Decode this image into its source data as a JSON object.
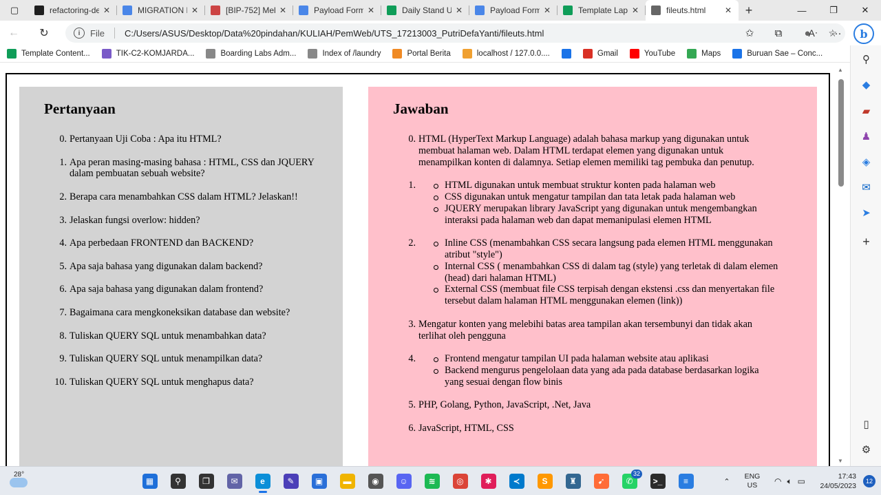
{
  "browser": {
    "tabs": [
      {
        "label": "refactoring-de",
        "icon": "github-icon",
        "color": "#1f1f1f"
      },
      {
        "label": "MIGRATION D",
        "icon": "docs-icon",
        "color": "#4a86e8"
      },
      {
        "label": "[BIP-752] Mel",
        "icon": "jira-icon",
        "color": "#c44"
      },
      {
        "label": "Payload Form",
        "icon": "docs-icon",
        "color": "#4a86e8"
      },
      {
        "label": "Daily Stand U",
        "icon": "sheets-icon",
        "color": "#0f9d58"
      },
      {
        "label": "Payload Form",
        "icon": "docs-icon",
        "color": "#4a86e8"
      },
      {
        "label": "Template Lap",
        "icon": "sheets-icon",
        "color": "#0f9d58"
      },
      {
        "label": "fileuts.html",
        "icon": "file-icon",
        "color": "#666666",
        "active": true
      }
    ],
    "address": {
      "scheme_label": "File",
      "url": "C:/Users/ASUS/Desktop/Data%20pindahan/KULIAH/PemWeb/UTS_17213003_PutriDefaYanti/fileuts.html"
    },
    "bookmarks": [
      {
        "label": "Template Content...",
        "icon": "sheets-icon",
        "color": "#0f9d58"
      },
      {
        "label": "TIK-C2-KOMJARDA...",
        "icon": "globe-icon",
        "color": "#7a5ac8"
      },
      {
        "label": "Boarding Labs Adm...",
        "icon": "page-icon",
        "color": "#888"
      },
      {
        "label": "Index of /laundry",
        "icon": "page-icon",
        "color": "#888"
      },
      {
        "label": "Portal Berita",
        "icon": "portal-icon",
        "color": "#f08a24"
      },
      {
        "label": "localhost / 127.0.0....",
        "icon": "phpmyadmin-icon",
        "color": "#f0a030"
      },
      {
        "label": "",
        "icon": "chat-icon",
        "color": "#1a73e8"
      },
      {
        "label": "Gmail",
        "icon": "gmail-icon",
        "color": "#d93025"
      },
      {
        "label": "YouTube",
        "icon": "youtube-icon",
        "color": "#ff0000"
      },
      {
        "label": "Maps",
        "icon": "maps-icon",
        "color": "#34a853"
      },
      {
        "label": "Buruan Sae – Conc...",
        "icon": "chat-icon",
        "color": "#1a73e8"
      }
    ]
  },
  "page": {
    "left_heading": "Pertanyaan",
    "right_heading": "Jawaban",
    "questions": [
      {
        "num": "0.",
        "text": "Pertanyaan Uji Coba : Apa itu HTML?"
      },
      {
        "num": "1.",
        "text": "Apa peran masing-masing bahasa : HTML, CSS dan JQUERY dalam pembuatan sebuah website?"
      },
      {
        "num": "2.",
        "text": "Berapa cara menambahkan CSS dalam HTML? Jelaskan!!"
      },
      {
        "num": "3.",
        "text": "Jelaskan fungsi overlow: hidden?"
      },
      {
        "num": "4.",
        "text": "Apa perbedaan FRONTEND dan BACKEND?"
      },
      {
        "num": "5.",
        "text": "Apa saja bahasa yang digunakan dalam backend?"
      },
      {
        "num": "6.",
        "text": "Apa saja bahasa yang digunakan dalam frontend?"
      },
      {
        "num": "7.",
        "text": "Bagaimana cara mengkoneksikan database dan website?"
      },
      {
        "num": "8.",
        "text": "Tuliskan QUERY SQL untuk menambahkan data?"
      },
      {
        "num": "9.",
        "text": "Tuliskan QUERY SQL untuk menampilkan data?"
      },
      {
        "num": "10.",
        "text": "Tuliskan QUERY SQL untuk menghapus data?"
      }
    ],
    "answers": [
      {
        "num": "0.",
        "text": "HTML (HyperText Markup Language) adalah bahasa markup yang digunakan untuk membuat halaman web. Dalam HTML terdapat elemen yang digunakan untuk menampilkan konten di dalamnya. Setiap elemen memiliki tag pembuka dan penutup.",
        "items": []
      },
      {
        "num": "1.",
        "text": "",
        "items": [
          "HTML digunakan untuk membuat struktur konten pada halaman web",
          "CSS digunakan untuk mengatur tampilan dan tata letak pada halaman web",
          "JQUERY merupakan library JavaScript yang digunakan untuk mengembangkan interaksi pada halaman web dan dapat memanipulasi elemen HTML"
        ]
      },
      {
        "num": "2.",
        "text": "",
        "items": [
          "Inline CSS (menambahkan CSS secara langsung pada elemen HTML menggunakan atribut \"style\")",
          "Internal CSS ( menambahkan CSS di dalam tag (style) yang terletak di dalam elemen (head) dari halaman HTML)",
          "External CSS (membuat file CSS terpisah dengan ekstensi .css dan menyertakan file tersebut dalam halaman HTML menggunakan elemen (link))"
        ]
      },
      {
        "num": "3.",
        "text": "Mengatur konten yang melebihi batas area tampilan akan tersembunyi dan tidak akan terlihat oleh pengguna",
        "items": []
      },
      {
        "num": "4.",
        "text": "",
        "items": [
          "Frontend mengatur tampilan UI pada halaman website atau aplikasi",
          "Backend mengurus pengelolaan data yang ada pada database berdasarkan logika yang sesuai dengan flow binis"
        ]
      },
      {
        "num": "5.",
        "text": "PHP, Golang, Python, JavaScript, .Net, Java",
        "items": []
      },
      {
        "num": "6.",
        "text": "JavaScript, HTML, CSS",
        "items": []
      }
    ],
    "colors": {
      "left_bg": "#d3d3d3",
      "right_bg": "#ffc0cb"
    }
  },
  "taskbar": {
    "weather_temp": "28°",
    "apps": [
      {
        "name": "start",
        "icon": "windows-icon",
        "color": "#1e6fd9",
        "glyph": "▦"
      },
      {
        "name": "search",
        "icon": "search-icon",
        "color": "#333",
        "glyph": "⚲"
      },
      {
        "name": "task-view",
        "icon": "taskview-icon",
        "color": "#333",
        "glyph": "❐"
      },
      {
        "name": "teams-chat",
        "icon": "chat-icon",
        "color": "#6264a7",
        "glyph": "✉"
      },
      {
        "name": "edge",
        "icon": "edge-icon",
        "color": "#0c8fd8",
        "glyph": "e",
        "active": true
      },
      {
        "name": "vs-editor",
        "icon": "editor-icon",
        "color": "#4b3fb8",
        "glyph": "✎"
      },
      {
        "name": "store",
        "icon": "store-icon",
        "color": "#2a6fd8",
        "glyph": "▣"
      },
      {
        "name": "explorer",
        "icon": "folder-icon",
        "color": "#f0b400",
        "glyph": "▬"
      },
      {
        "name": "camera",
        "icon": "camera-icon",
        "color": "#555",
        "glyph": "◉"
      },
      {
        "name": "discord",
        "icon": "discord-icon",
        "color": "#5865f2",
        "glyph": "☺"
      },
      {
        "name": "spotify",
        "icon": "spotify-icon",
        "color": "#1db954",
        "glyph": "≋"
      },
      {
        "name": "chrome",
        "icon": "chrome-icon",
        "color": "#db4437",
        "glyph": "◎"
      },
      {
        "name": "slack",
        "icon": "slack-icon",
        "color": "#e01e5a",
        "glyph": "✱"
      },
      {
        "name": "vscode",
        "icon": "vscode-icon",
        "color": "#007acc",
        "glyph": "≺"
      },
      {
        "name": "sublime",
        "icon": "sublime-icon",
        "color": "#ff9800",
        "glyph": "S"
      },
      {
        "name": "pgadmin",
        "icon": "database-icon",
        "color": "#336791",
        "glyph": "♜"
      },
      {
        "name": "postman",
        "icon": "postman-icon",
        "color": "#ff6c37",
        "glyph": "➹"
      },
      {
        "name": "whatsapp",
        "icon": "whatsapp-icon",
        "color": "#25d366",
        "glyph": "✆",
        "badge": "32"
      },
      {
        "name": "terminal",
        "icon": "terminal-icon",
        "color": "#2b2b2b",
        "glyph": ">_"
      },
      {
        "name": "notepad",
        "icon": "notepad-icon",
        "color": "#2a7de1",
        "glyph": "≡"
      }
    ],
    "lang_line1": "ENG",
    "lang_line2": "US",
    "time": "17:43",
    "date": "24/05/2023",
    "notifications": "12"
  }
}
